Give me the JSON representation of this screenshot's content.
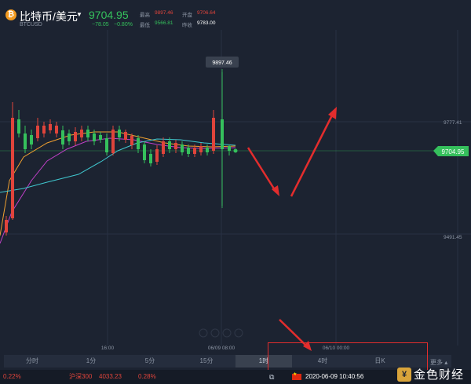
{
  "header": {
    "coin_icon": "bitcoin-icon",
    "pair_name": "比特币/美元",
    "pair_code": "BTCUSD",
    "last_price": "9704.95",
    "change": "−78.05",
    "change_pct": "−0.80%",
    "stats": [
      {
        "label": "最高",
        "value": "9897.46",
        "color": "#e0443b"
      },
      {
        "label": "开盘",
        "value": "9706.64",
        "color": "#e0443b"
      },
      {
        "label": "最低",
        "value": "9566.81",
        "color": "#35c05c"
      },
      {
        "label": "昨收",
        "value": "9783.00",
        "color": "#ffffff"
      }
    ]
  },
  "chart_labels": {
    "high_marker": "9897.46",
    "current_price": "9704.95",
    "y_ticks": [
      "9777.41",
      "9491.45"
    ],
    "x_ticks": [
      "16:00",
      "06/09 08:00",
      "06/10 00:00"
    ]
  },
  "tabs": [
    {
      "label": "分时"
    },
    {
      "label": "1分"
    },
    {
      "label": "5分"
    },
    {
      "label": "15分"
    },
    {
      "label": "1时"
    },
    {
      "label": "4时"
    },
    {
      "label": "日K"
    }
  ],
  "more_label": "更多 ▴",
  "ticker": {
    "left_pct": "0.22%",
    "index_name": "沪深300",
    "index_value": "4033.23",
    "index_pct": "0.28%",
    "datetime": "2020-06-09 10:40:56"
  },
  "brand": {
    "badge": "¥",
    "name": "金色财经"
  },
  "colors": {
    "up": "#e0443b",
    "down": "#35c05c",
    "background": "#1c2331",
    "annotation": "#e32d2d"
  }
}
